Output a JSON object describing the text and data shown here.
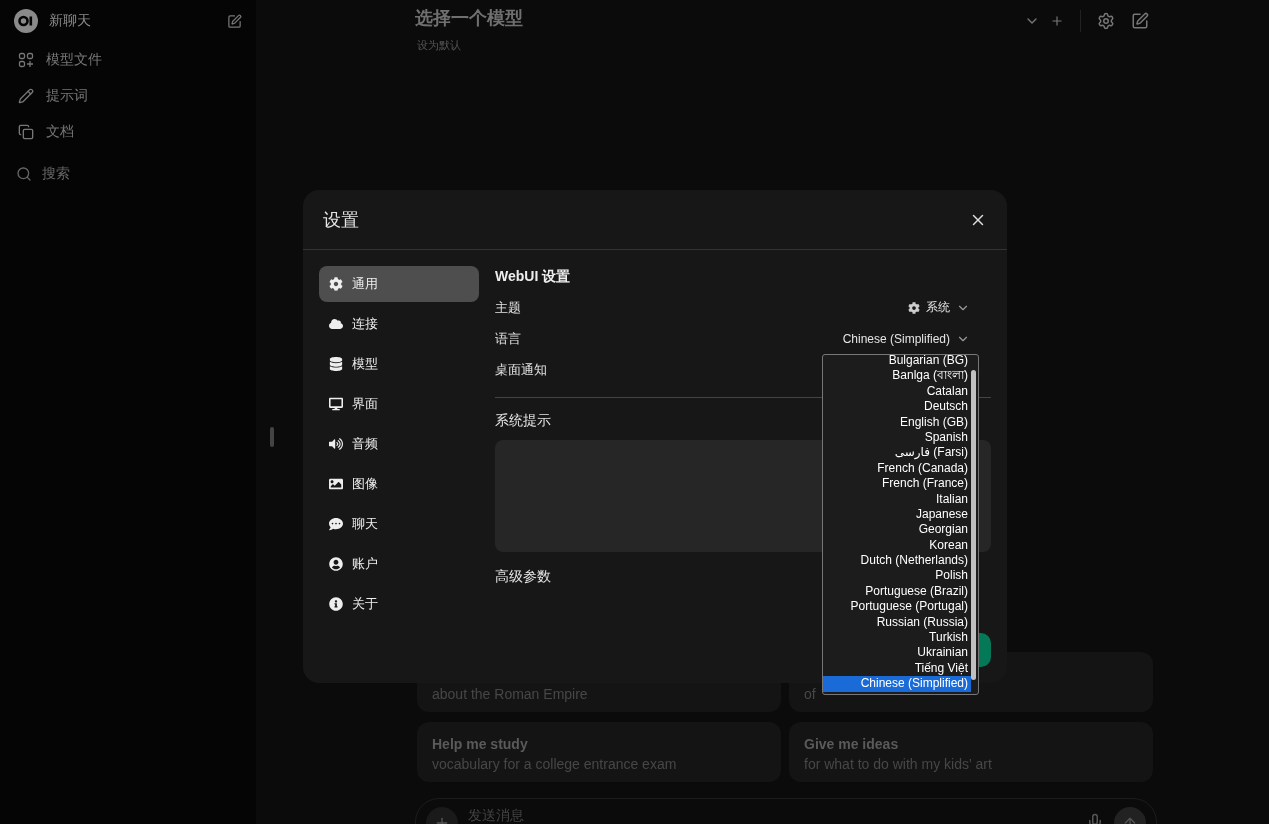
{
  "sidebar": {
    "title": "新聊天",
    "items": [
      {
        "label": "模型文件"
      },
      {
        "label": "提示词"
      },
      {
        "label": "文档"
      }
    ],
    "search": "搜索"
  },
  "header": {
    "title": "选择一个模型",
    "subtitle": "设为默认"
  },
  "suggestions": [
    {
      "subtitle": "about the Roman Empire"
    },
    {
      "subtitle": "of"
    },
    {
      "title": "Help me study",
      "subtitle": "vocabulary for a college entrance exam"
    },
    {
      "title": "Give me ideas",
      "subtitle": "for what to do with my kids' art"
    }
  ],
  "composer": {
    "placeholder": "发送消息"
  },
  "settings": {
    "title": "设置",
    "nav": [
      {
        "label": "通用",
        "selected": true
      },
      {
        "label": "连接",
        "selected": false
      },
      {
        "label": "模型",
        "selected": false
      },
      {
        "label": "界面",
        "selected": false
      },
      {
        "label": "音频",
        "selected": false
      },
      {
        "label": "图像",
        "selected": false
      },
      {
        "label": "聊天",
        "selected": false
      },
      {
        "label": "账户",
        "selected": false
      },
      {
        "label": "关于",
        "selected": false
      }
    ],
    "section": "WebUI 设置",
    "rows": [
      {
        "kind": "theme",
        "label": "主题",
        "value": "系统"
      },
      {
        "kind": "select",
        "label": "语言",
        "value": "Chinese (Simplified)"
      },
      {
        "kind": "plain",
        "label": "桌面通知"
      }
    ],
    "system_prompt_label": "系统提示",
    "advanced_label": "高级参数",
    "language_menu": [
      {
        "label": "Bulgarian (BG)",
        "selected": false
      },
      {
        "label": "Banlga (বাংলা)",
        "selected": false
      },
      {
        "label": "Catalan",
        "selected": false
      },
      {
        "label": "Deutsch",
        "selected": false
      },
      {
        "label": "English (GB)",
        "selected": false
      },
      {
        "label": "Spanish",
        "selected": false
      },
      {
        "label": "فارسی (Farsi)",
        "selected": false
      },
      {
        "label": "French (Canada)",
        "selected": false
      },
      {
        "label": "French (France)",
        "selected": false
      },
      {
        "label": "Italian",
        "selected": false
      },
      {
        "label": "Japanese",
        "selected": false
      },
      {
        "label": "Georgian",
        "selected": false
      },
      {
        "label": "Korean",
        "selected": false
      },
      {
        "label": "Dutch (Netherlands)",
        "selected": false
      },
      {
        "label": "Polish",
        "selected": false
      },
      {
        "label": "Portuguese (Brazil)",
        "selected": false
      },
      {
        "label": "Portuguese (Portugal)",
        "selected": false
      },
      {
        "label": "Russian (Russia)",
        "selected": false
      },
      {
        "label": "Turkish",
        "selected": false
      },
      {
        "label": "Ukrainian",
        "selected": false
      },
      {
        "label": "Tiếng Việt",
        "selected": false
      },
      {
        "label": "Chinese (Simplified)",
        "selected": true
      }
    ]
  }
}
